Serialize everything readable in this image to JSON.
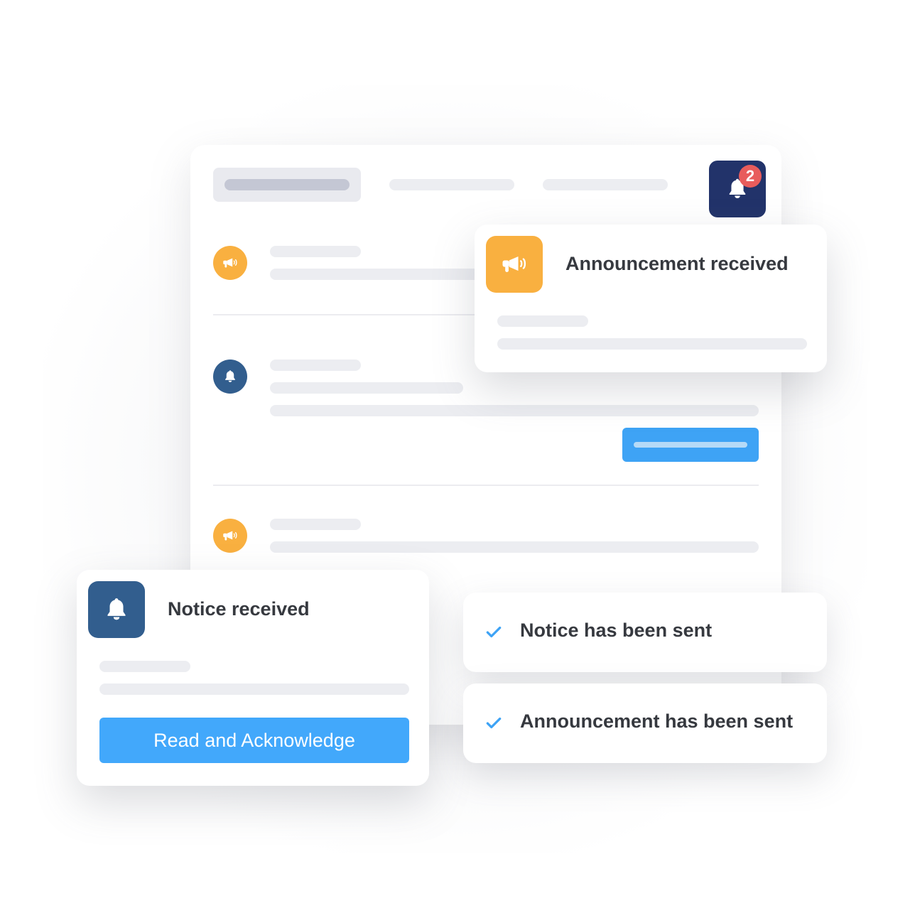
{
  "header": {
    "notification_count": "2"
  },
  "colors": {
    "announcement": "#f9b040",
    "notice": "#325e8e",
    "bell_button": "#22336a",
    "badge": "#e85c5c",
    "primary": "#42a8fb",
    "check": "#3ea3f5",
    "text": "#36393f"
  },
  "feed": {
    "items": [
      {
        "type": "announcement",
        "icon": "megaphone-icon"
      },
      {
        "type": "notice",
        "icon": "bell-icon"
      },
      {
        "type": "announcement",
        "icon": "megaphone-icon"
      }
    ]
  },
  "announcement_popup": {
    "icon": "megaphone-icon",
    "title": "Announcement received"
  },
  "notice_popup": {
    "icon": "bell-icon",
    "title": "Notice received",
    "button_label": "Read and Acknowledge"
  },
  "sent_confirmations": [
    {
      "icon": "check-icon",
      "text": "Notice has been sent"
    },
    {
      "icon": "check-icon",
      "text": "Announcement has been sent"
    }
  ]
}
